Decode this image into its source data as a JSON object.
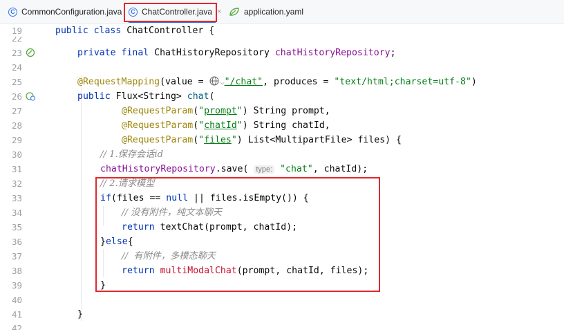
{
  "tabs": [
    {
      "label": "CommonConfiguration.java",
      "icon": "java-class-icon"
    },
    {
      "label": "ChatController.java",
      "icon": "java-class-icon",
      "active": true,
      "close": "×"
    },
    {
      "label": "application.yaml",
      "icon": "spring-leaf-icon"
    }
  ],
  "lines": [
    {
      "num": "19"
    },
    {
      "num": "22"
    },
    {
      "num": "23"
    },
    {
      "num": "24"
    },
    {
      "num": "25"
    },
    {
      "num": "26"
    },
    {
      "num": "27"
    },
    {
      "num": "28"
    },
    {
      "num": "29"
    },
    {
      "num": "30"
    },
    {
      "num": "31"
    },
    {
      "num": "32"
    },
    {
      "num": "33"
    },
    {
      "num": "34"
    },
    {
      "num": "35"
    },
    {
      "num": "36"
    },
    {
      "num": "37"
    },
    {
      "num": "38"
    },
    {
      "num": "39"
    },
    {
      "num": "40"
    },
    {
      "num": "41"
    },
    {
      "num": "42"
    }
  ],
  "code": {
    "l19_kw": "public class ",
    "l19_rest": "ChatController {",
    "l23_kw": "private final ",
    "l23_type": "ChatHistoryRepository ",
    "l23_field": "chatHistoryRepository",
    "l23_end": ";",
    "l25_ann": "@RequestMapping",
    "l25_a": "(value = ",
    "l25_globe": "⌵",
    "l25_s1": "\"/chat\"",
    "l25_b": ", produces = ",
    "l25_s2": "\"text/html;charset=utf-8\"",
    "l25_end": ")",
    "l26_kw": "public ",
    "l26_type": "Flux<String> ",
    "l26_fn": "chat",
    "l26_end": "(",
    "l27_ann": "@RequestParam",
    "l27_a": "(",
    "l27_s": "\"prompt\"",
    "l27_s_word": "prompt",
    "l27_rest": ") String prompt,",
    "l28_ann": "@RequestParam",
    "l28_a": "(",
    "l28_s_word": "chatId",
    "l28_rest": ") String chatId,",
    "l29_ann": "@RequestParam",
    "l29_a": "(",
    "l29_s_word": "files",
    "l29_rest": ") List<MultipartFile> files) {",
    "l30_cmt": "// 1.保存会话id",
    "l31_field": "chatHistoryRepository",
    "l31_a": ".save( ",
    "l31_hint": "type:",
    "l31_s": " \"chat\"",
    "l31_rest": ", chatId);",
    "l32_cmt": "// 2.请求模型",
    "l33_kw": "if",
    "l33_a": "(files == ",
    "l33_null": "null",
    "l33_rest": " || files.isEmpty()) {",
    "l34_cmt": "// 没有附件，纯文本聊天",
    "l35_kw": "return ",
    "l35_rest": "textChat(prompt, chatId);",
    "l36_a": "}",
    "l36_kw": "else",
    "l36_b": "{",
    "l37_cmt": "//  有附件，多模态聊天",
    "l38_kw": "return ",
    "l38_fn": "multiModalChat",
    "l38_rest": "(prompt, chatId, files);",
    "l39": "}",
    "l41": "}"
  }
}
